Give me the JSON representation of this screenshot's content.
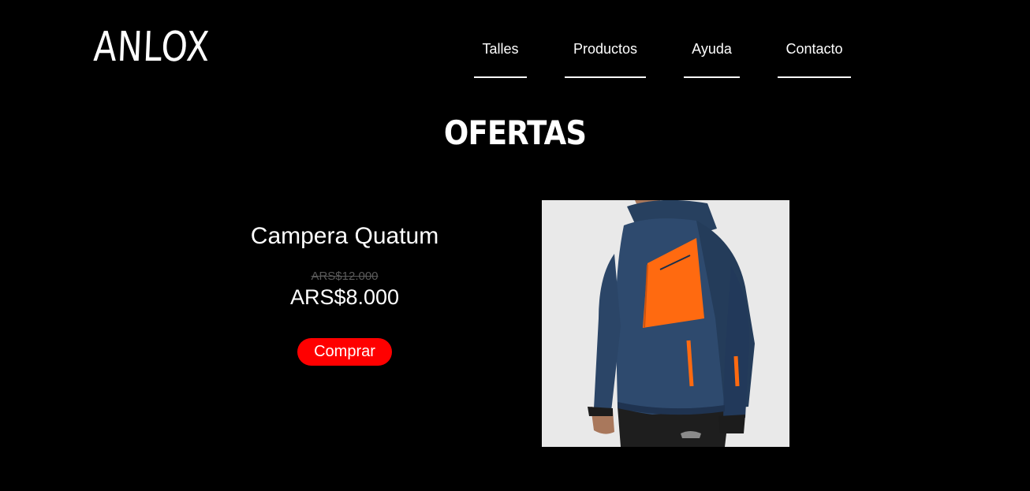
{
  "brand": {
    "logo_text": "ANLOX"
  },
  "nav": {
    "items": [
      {
        "label": "Talles"
      },
      {
        "label": "Productos"
      },
      {
        "label": "Ayuda"
      },
      {
        "label": "Contacto"
      }
    ]
  },
  "section": {
    "title": "OFERTAS"
  },
  "product": {
    "name": "Campera Quatum",
    "old_price": "ARS$12.000",
    "new_price": "ARS$8.000",
    "buy_label": "Comprar",
    "image_subject": "jacket-photo"
  },
  "colors": {
    "background": "#000000",
    "text": "#ffffff",
    "button": "#ff0000",
    "old_price": "#5a5a5a",
    "jacket_body": "#2e4a6e",
    "jacket_accent": "#ff6a10"
  }
}
